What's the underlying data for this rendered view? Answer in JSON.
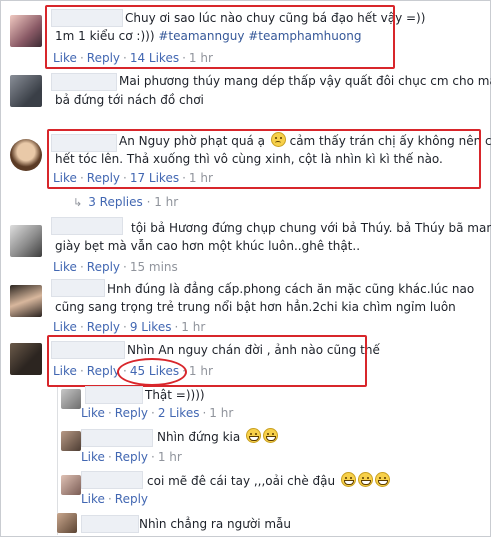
{
  "actions": {
    "like": "Like",
    "reply": "Reply"
  },
  "comments": [
    {
      "line1": "Chuy ơi sao lúc nào chuy cũng bá đạo hết vậy =))",
      "line2_plain": "1m 1 kiểu cơ :))) ",
      "hashtags": "#teamannguy #teamphamhuong",
      "likes": "14 Likes",
      "time": "1 hr"
    },
    {
      "line1": "Mai phương thúy mang dép thấp vậy quất đôi chục cm cho mấy",
      "line2": "bả đứng tới nách đồ chơi"
    },
    {
      "line1_a": "An Nguy phờ phạt quá ạ ",
      "line1_b": " cảm thấy trán chị ấy không nên cột",
      "line2": "hết tóc lên. Thả xuống thì vô cùng xinh, cột là nhìn kì kì thế nào.",
      "likes": "17 Likes",
      "time": "1 hr"
    },
    {
      "line1": "tội bả Hương đứng chụp chung với bả Thúy. bả Thúy bã mang",
      "line2": "giày bẹt mà vẫn cao hơn một khúc luôn..ghê thật..",
      "time": "15 mins"
    },
    {
      "line1": "Hnh đúng là đẳng cấp.phong cách ăn mặc cũng khác.lúc nao",
      "line2": "cũng sang trọng trẻ trung nổi bật hơn hẳn.2chi kia chìm ngỉm luôn",
      "likes": "9 Likes",
      "time": "1 hr"
    },
    {
      "line1": "Nhìn An nguy chán đời , ảnh nào cũng thế",
      "likes": "45 Likes",
      "time": "1 hr"
    }
  ],
  "replies_toggle": "3 Replies",
  "replies_time": "1 hr",
  "nested": [
    {
      "text": "Thật =))))",
      "likes": "2 Likes",
      "time": "1 hr"
    },
    {
      "text": "Nhìn đứng kia ",
      "time": "1 hr"
    },
    {
      "text": "coi mẽ đê cái tay ,,,oải chè đậu "
    },
    {
      "text": "Nhìn chẳng ra người mẫu"
    }
  ],
  "emojis": [
    "frowning-face",
    "grinning-face"
  ],
  "colors": {
    "link": "#4267b2",
    "meta": "#90949c",
    "highlight": "#d8262b",
    "text": "#1d2129"
  }
}
